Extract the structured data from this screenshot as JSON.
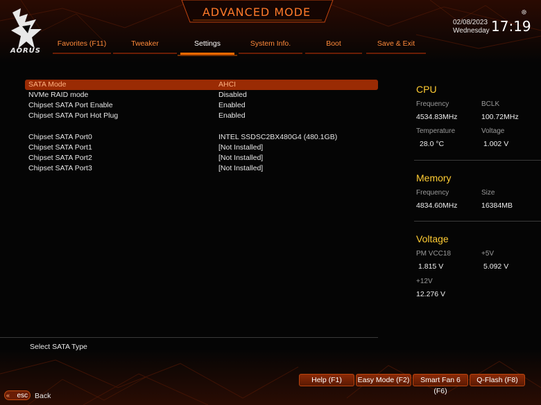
{
  "header": {
    "title": "ADVANCED MODE",
    "date": "02/08/2023",
    "weekday": "Wednesday",
    "time": "17:19",
    "logo_text": "AORUS"
  },
  "tabs": [
    {
      "label": "Favorites (F11)",
      "active": false
    },
    {
      "label": "Tweaker",
      "active": false
    },
    {
      "label": "Settings",
      "active": true
    },
    {
      "label": "System Info.",
      "active": false
    },
    {
      "label": "Boot",
      "active": false
    },
    {
      "label": "Save & Exit",
      "active": false
    }
  ],
  "settings": [
    {
      "label": "SATA Mode",
      "value": "AHCI",
      "selected": true
    },
    {
      "label": "NVMe RAID mode",
      "value": "Disabled"
    },
    {
      "label": "Chipset SATA Port Enable",
      "value": "Enabled"
    },
    {
      "label": "Chipset SATA Port Hot Plug",
      "value": "Enabled"
    },
    {
      "label": "Chipset SATA Port0",
      "value": "INTEL SSDSC2BX480G4 (480.1GB)"
    },
    {
      "label": "Chipset SATA Port1",
      "value": "[Not Installed]"
    },
    {
      "label": "Chipset SATA Port2",
      "value": "[Not Installed]"
    },
    {
      "label": "Chipset SATA Port3",
      "value": "[Not Installed]"
    }
  ],
  "help_text": "Select SATA Type",
  "monitor": {
    "cpu": {
      "title": "CPU",
      "frequency_label": "Frequency",
      "frequency": "4534.83MHz",
      "bclk_label": "BCLK",
      "bclk": "100.72MHz",
      "temperature_label": "Temperature",
      "temperature": "28.0 °C",
      "voltage_label": "Voltage",
      "voltage": "1.002 V"
    },
    "memory": {
      "title": "Memory",
      "frequency_label": "Frequency",
      "frequency": "4834.60MHz",
      "size_label": "Size",
      "size": "16384MB"
    },
    "voltage": {
      "title": "Voltage",
      "pmvcc18_label": "PM VCC18",
      "pmvcc18": "1.815 V",
      "p5v_label": "+5V",
      "p5v": "5.092 V",
      "p12v_label": "+12V",
      "p12v": "12.276 V"
    }
  },
  "footer": {
    "help": "Help (F1)",
    "easy_mode": "Easy Mode (F2)",
    "smart_fan": "Smart Fan 6 (F6)",
    "qflash": "Q-Flash (F8)",
    "esc": "esc",
    "back": "Back"
  },
  "colors": {
    "accent": "#ff6a00",
    "title": "#ff7a2a",
    "tab": "#ff8a3a",
    "monitor_title": "#ffcc33",
    "selected_row": "#9a2b04"
  }
}
